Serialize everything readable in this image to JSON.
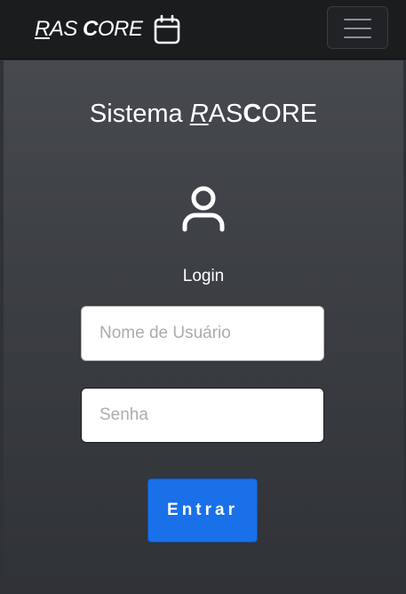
{
  "navbar": {
    "brand_part1": "R",
    "brand_part2": "AS ",
    "brand_part3": "C",
    "brand_part4": "ORE",
    "brand_icon": "calendar-icon",
    "menu_icon": "hamburger-menu-icon"
  },
  "main": {
    "title_prefix": "Sistema ",
    "title_part1": "R",
    "title_part2": "AS",
    "title_part3": "C",
    "title_part4": "ORE",
    "user_icon": "user-icon",
    "login_label": "Login",
    "username_placeholder": "Nome de Usuário",
    "password_placeholder": "Senha",
    "submit_label": "Entrar"
  },
  "colors": {
    "navbar_bg": "#1b1c1e",
    "page_bg": "#3b3e43",
    "button_bg": "#1a70e8",
    "text": "#ffffff"
  }
}
